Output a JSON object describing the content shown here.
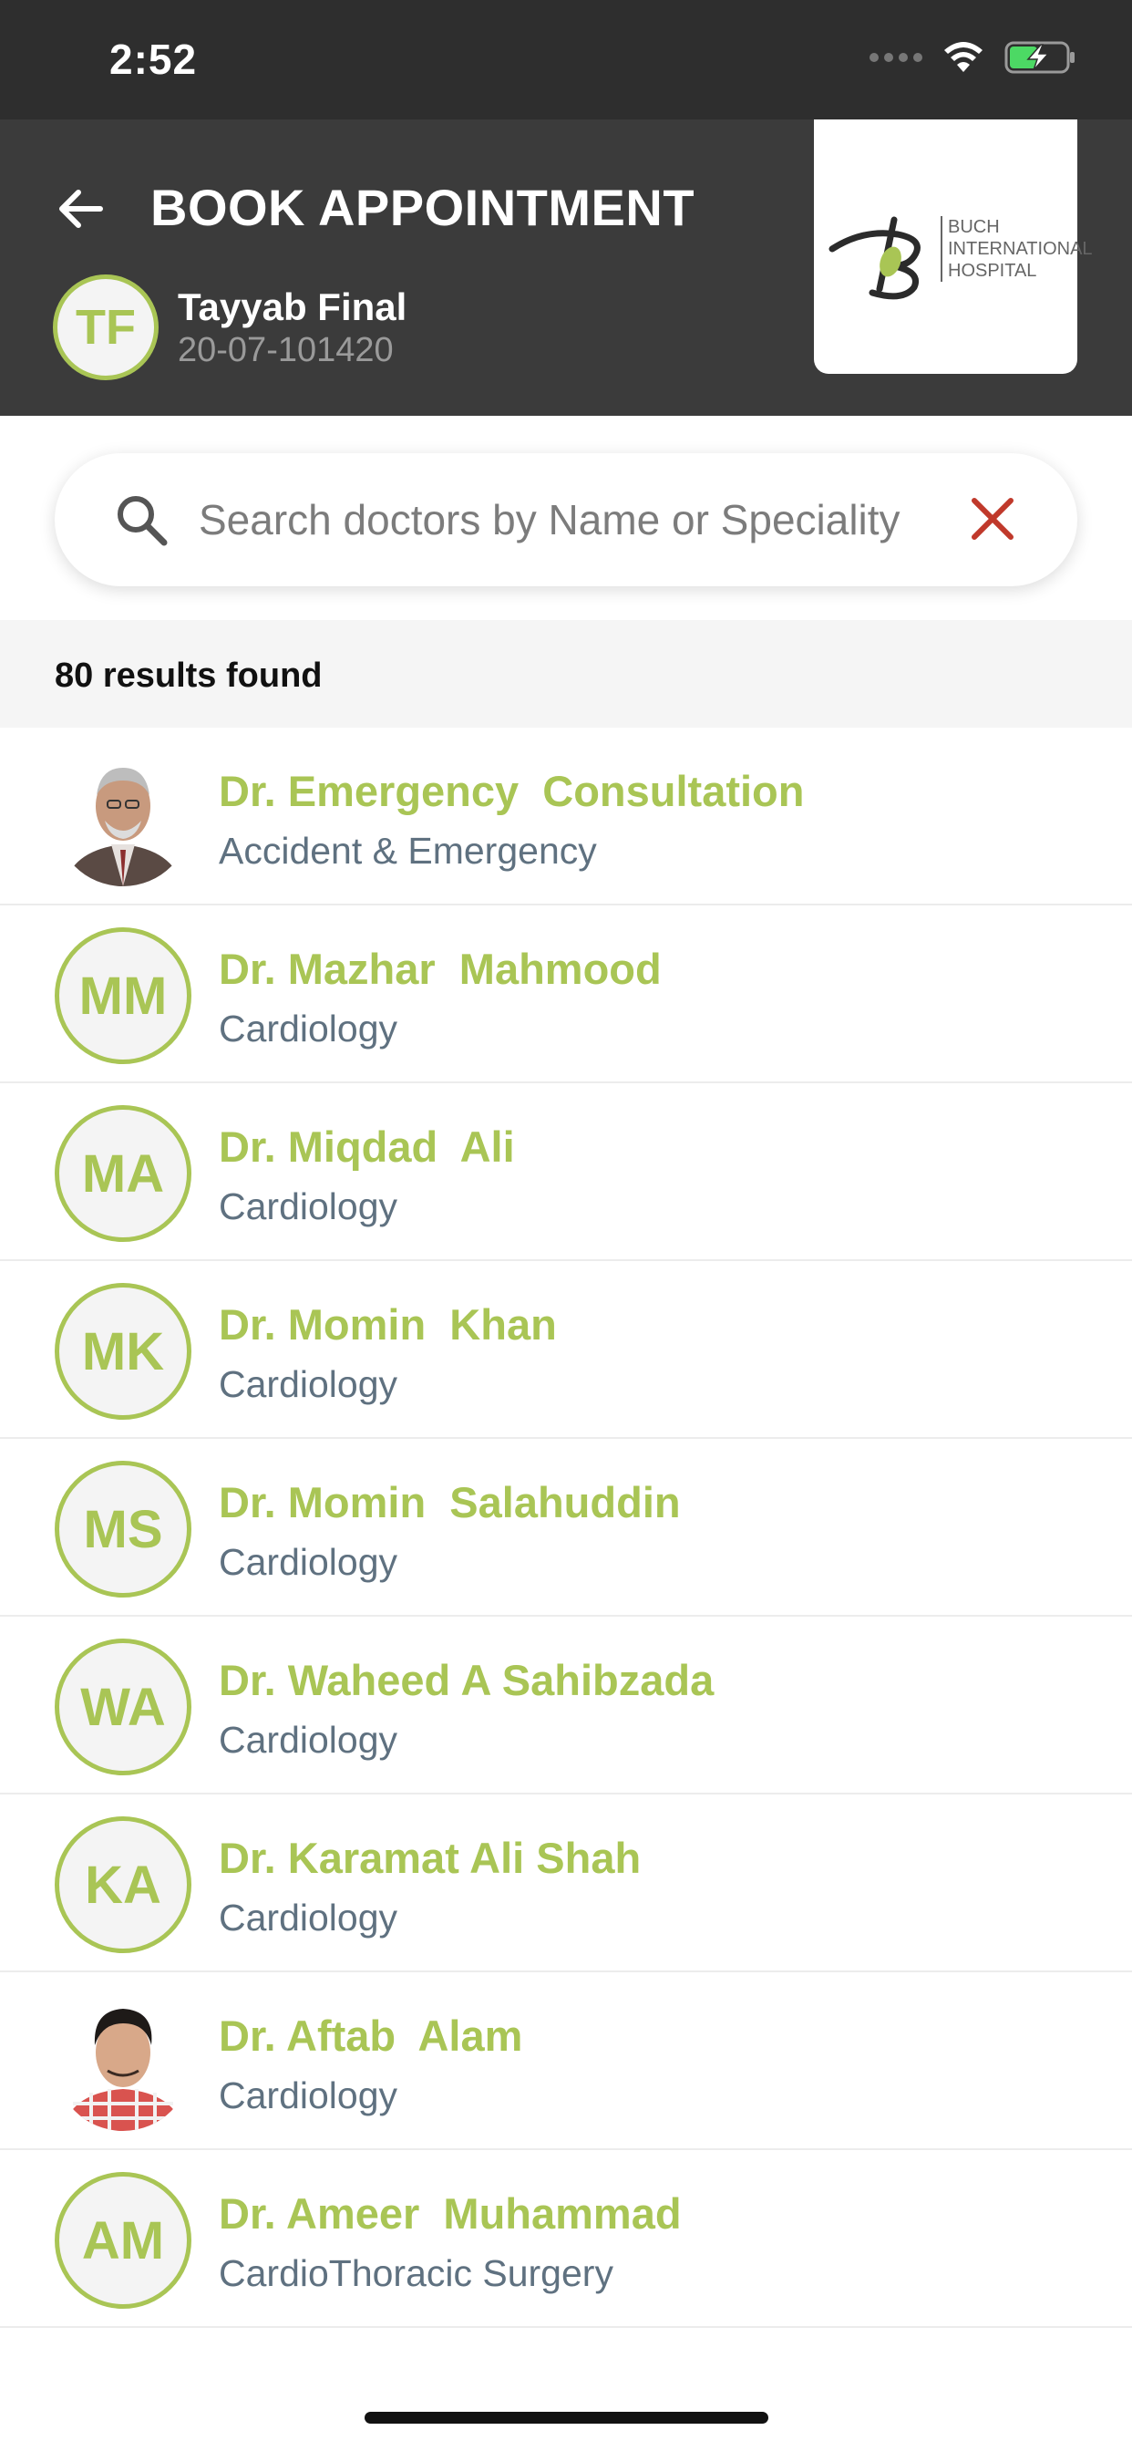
{
  "status_bar": {
    "time": "2:52"
  },
  "header": {
    "title": "BOOK APPOINTMENT",
    "patient": {
      "initials": "TF",
      "name": "Tayyab Final",
      "id": "20-07-101420"
    },
    "logo": {
      "line1": "BUCH",
      "line2": "INTERNATIONAL",
      "line3": "HOSPITAL"
    }
  },
  "search": {
    "placeholder": "Search doctors by Name or Speciality",
    "value": ""
  },
  "results": {
    "count_text": "80 results found"
  },
  "doctors": [
    {
      "initials": "",
      "has_photo": true,
      "name": "Dr. Emergency  Consultation",
      "speciality": "Accident & Emergency"
    },
    {
      "initials": "MM",
      "has_photo": false,
      "name": "Dr. Mazhar  Mahmood",
      "speciality": "Cardiology"
    },
    {
      "initials": "MA",
      "has_photo": false,
      "name": "Dr. Miqdad  Ali",
      "speciality": "Cardiology"
    },
    {
      "initials": "MK",
      "has_photo": false,
      "name": "Dr. Momin  Khan",
      "speciality": "Cardiology"
    },
    {
      "initials": "MS",
      "has_photo": false,
      "name": "Dr. Momin  Salahuddin",
      "speciality": "Cardiology"
    },
    {
      "initials": "WA",
      "has_photo": false,
      "name": "Dr. Waheed A Sahibzada",
      "speciality": "Cardiology"
    },
    {
      "initials": "KA",
      "has_photo": false,
      "name": "Dr. Karamat Ali Shah",
      "speciality": "Cardiology"
    },
    {
      "initials": "",
      "has_photo": true,
      "name": "Dr. Aftab  Alam",
      "speciality": "Cardiology"
    },
    {
      "initials": "AM",
      "has_photo": false,
      "name": "Dr. Ameer  Muhammad",
      "speciality": "CardioThoracic Surgery"
    }
  ],
  "colors": {
    "accent": "#a9c555",
    "header_bg": "#3b3b3b",
    "status_bg": "#2e2e2e",
    "clear_icon": "#c0392b",
    "speciality_text": "#5f7180"
  },
  "icons": {
    "back": "arrow-left-icon",
    "search": "search-icon",
    "clear": "close-icon",
    "wifi": "wifi-icon",
    "battery": "battery-charging-icon"
  }
}
